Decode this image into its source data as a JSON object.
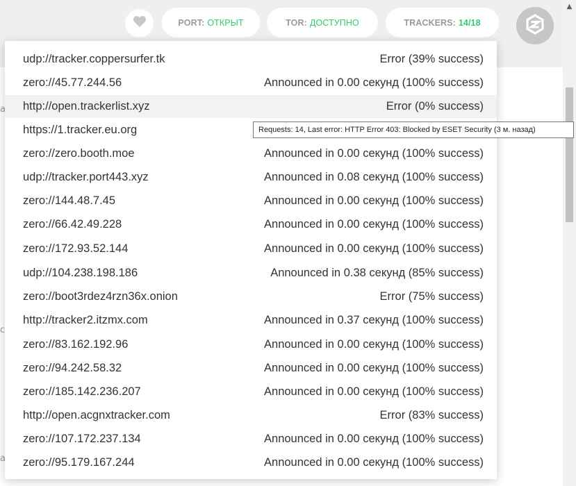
{
  "header": {
    "port": {
      "label": "PORT:",
      "value": "ОТКРЫТ"
    },
    "tor": {
      "label": "TOR:",
      "value": "ДОСТУПНО"
    },
    "trackers": {
      "label": "TRACKERS:",
      "value": "14/18"
    }
  },
  "colors": {
    "accent_green": "#2ecc71",
    "pill_text": "#9a9a9a",
    "logo_bg": "#c6c6c6"
  },
  "icons": {
    "heart": "heart-icon",
    "logo": "zeronet-logo-icon",
    "scroll_up": "arrow-up-icon"
  },
  "background": {
    "edge_chars": [
      "a",
      "c",
      "a"
    ]
  },
  "trackers": [
    {
      "address": "udp://tracker.coppersurfer.tk",
      "status": "Error (39% success)"
    },
    {
      "address": "zero://45.77.244.56",
      "status": "Announced in 0.00 секунд (100% success)"
    },
    {
      "address": "http://open.trackerlist.xyz",
      "status": "Error (0% success)"
    },
    {
      "address": "https://1.tracker.eu.org",
      "status": ""
    },
    {
      "address": "zero://zero.booth.moe",
      "status": "Announced in 0.00 секунд (100% success)"
    },
    {
      "address": "udp://tracker.port443.xyz",
      "status": "Announced in 0.08 секунд (100% success)"
    },
    {
      "address": "zero://144.48.7.45",
      "status": "Announced in 0.00 секунд (100% success)"
    },
    {
      "address": "zero://66.42.49.228",
      "status": "Announced in 0.00 секунд (100% success)"
    },
    {
      "address": "zero://172.93.52.144",
      "status": "Announced in 0.00 секунд (100% success)"
    },
    {
      "address": "udp://104.238.198.186",
      "status": "Announced in 0.38 секунд (85% success)"
    },
    {
      "address": "zero://boot3rdez4rzn36x.onion",
      "status": "Error (75% success)"
    },
    {
      "address": "http://tracker2.itzmx.com",
      "status": "Announced in 0.37 секунд (100% success)"
    },
    {
      "address": "zero://83.162.192.96",
      "status": "Announced in 0.00 секунд (100% success)"
    },
    {
      "address": "zero://94.242.58.32",
      "status": "Announced in 0.00 секунд (100% success)"
    },
    {
      "address": "zero://185.142.236.207",
      "status": "Announced in 0.00 секунд (100% success)"
    },
    {
      "address": "http://open.acgnxtracker.com",
      "status": "Error (83% success)"
    },
    {
      "address": "zero://107.172.237.134",
      "status": "Announced in 0.00 секунд (100% success)"
    },
    {
      "address": "zero://95.179.167.244",
      "status": "Announced in 0.00 секунд (100% success)"
    }
  ],
  "tooltip": {
    "text": "Requests: 14, Last error: HTTP Error 403: Blocked by ESET Security (3 м. назад)"
  }
}
